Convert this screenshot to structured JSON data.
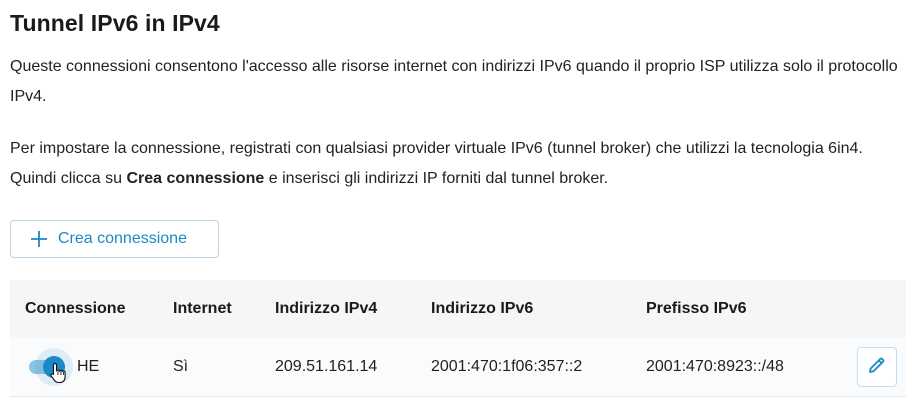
{
  "page": {
    "title": "Tunnel IPv6 in IPv4",
    "paragraph1": "Queste connessioni consentono l'accesso alle risorse internet con indirizzi IPv6 quando il proprio ISP utilizza solo il protocollo IPv4.",
    "paragraph2_before": "Per impostare la connessione, registrati con qualsiasi provider virtuale IPv6 (tunnel broker) che utilizzi la tecnologia 6in4. Quindi clicca su ",
    "paragraph2_bold": "Crea connessione",
    "paragraph2_after": " e inserisci gli indirizzi IP forniti dal tunnel broker."
  },
  "actions": {
    "create_label": "Crea connessione",
    "create_icon": "plus-icon"
  },
  "table": {
    "headers": [
      "Connessione",
      "Internet",
      "Indirizzo IPv4",
      "Indirizzo IPv6",
      "Prefisso IPv6"
    ],
    "rows": [
      {
        "enabled": true,
        "connection": "HE",
        "internet": "Sì",
        "ipv4": "209.51.161.14",
        "ipv6": "2001:470:1f06:357::2",
        "prefix": "2001:470:8923::/48"
      }
    ]
  },
  "colors": {
    "accent": "#1b89c7",
    "header_bg": "#f4f6f8"
  }
}
